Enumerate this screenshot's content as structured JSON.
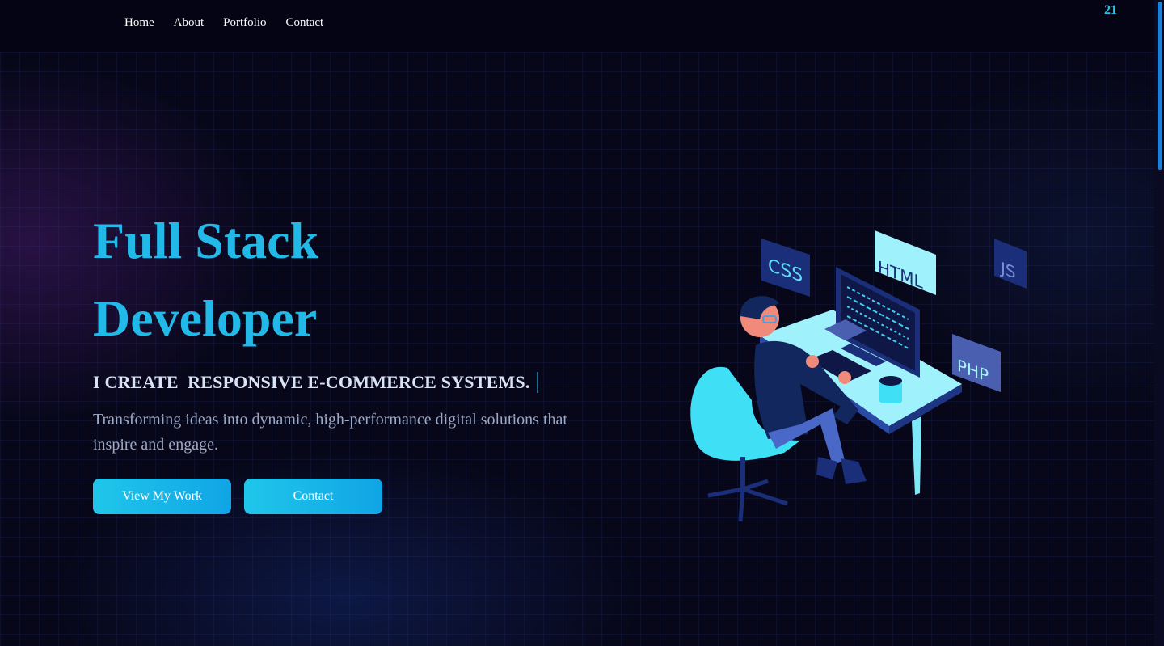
{
  "nav": {
    "items": [
      {
        "label": "Home"
      },
      {
        "label": "About"
      },
      {
        "label": "Portfolio"
      },
      {
        "label": "Contact"
      }
    ],
    "counter": "21"
  },
  "hero": {
    "title_line1": "Full Stack",
    "title_line2": "Developer",
    "typed_text": "I CREATE  RESPONSIVE E-COMMERCE SYSTEMS.",
    "description": "Transforming ideas into dynamic, high-performance digital solutions that inspire and engage.",
    "buttons": {
      "primary": "View My Work",
      "secondary": "Contact"
    }
  },
  "illustration": {
    "tags": [
      "CSS",
      "HTML",
      "JS",
      "PHP"
    ],
    "icon": "developer-at-desk-illustration"
  },
  "colors": {
    "background": "#070719",
    "accent": "#22b8e8",
    "button": "#18b6e8"
  }
}
